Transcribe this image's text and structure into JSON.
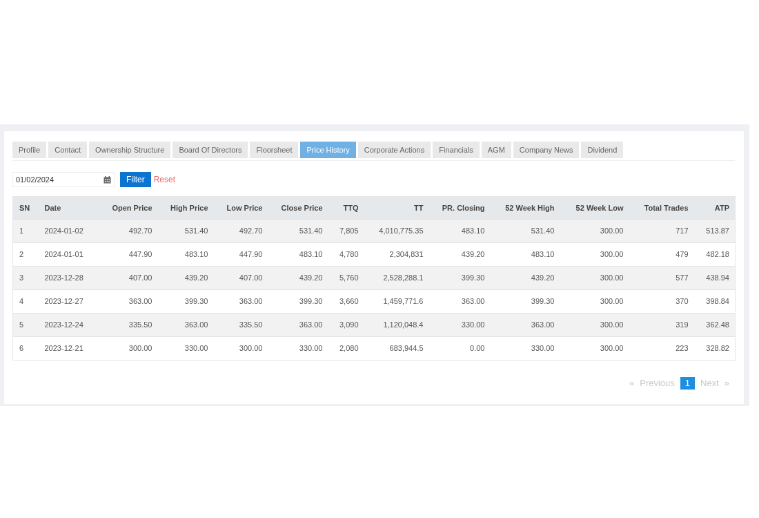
{
  "tabs": [
    {
      "label": "Profile",
      "selected": false
    },
    {
      "label": "Contact",
      "selected": false
    },
    {
      "label": "Ownership Structure",
      "selected": false
    },
    {
      "label": "Board Of Directors",
      "selected": false
    },
    {
      "label": "Floorsheet",
      "selected": false
    },
    {
      "label": "Price History",
      "selected": true
    },
    {
      "label": "Corporate Actions",
      "selected": false
    },
    {
      "label": "Financials",
      "selected": false
    },
    {
      "label": "AGM",
      "selected": false
    },
    {
      "label": "Company News",
      "selected": false
    },
    {
      "label": "Dividend",
      "selected": false
    }
  ],
  "filter": {
    "date": "01/02/2024",
    "filter_button": "Filter",
    "reset_link": "Reset"
  },
  "table": {
    "columns": [
      "SN",
      "Date",
      "Open Price",
      "High Price",
      "Low Price",
      "Close Price",
      "TTQ",
      "TT",
      "PR. Closing",
      "52 Week High",
      "52 Week Low",
      "Total Trades",
      "ATP"
    ],
    "rows": [
      [
        "1",
        "2024-01-02",
        "492.70",
        "531.40",
        "492.70",
        "531.40",
        "7,805",
        "4,010,775.35",
        "483.10",
        "531.40",
        "300.00",
        "717",
        "513.87"
      ],
      [
        "2",
        "2024-01-01",
        "447.90",
        "483.10",
        "447.90",
        "483.10",
        "4,780",
        "2,304,831",
        "439.20",
        "483.10",
        "300.00",
        "479",
        "482.18"
      ],
      [
        "3",
        "2023-12-28",
        "407.00",
        "439.20",
        "407.00",
        "439.20",
        "5,760",
        "2,528,288.1",
        "399.30",
        "439.20",
        "300.00",
        "577",
        "438.94"
      ],
      [
        "4",
        "2023-12-27",
        "363.00",
        "399.30",
        "363.00",
        "399.30",
        "3,660",
        "1,459,771.6",
        "363.00",
        "399.30",
        "300.00",
        "370",
        "398.84"
      ],
      [
        "5",
        "2023-12-24",
        "335.50",
        "363.00",
        "335.50",
        "363.00",
        "3,090",
        "1,120,048.4",
        "330.00",
        "363.00",
        "300.00",
        "319",
        "362.48"
      ],
      [
        "6",
        "2023-12-21",
        "300.00",
        "330.00",
        "300.00",
        "330.00",
        "2,080",
        "683,944.5",
        "0.00",
        "330.00",
        "300.00",
        "223",
        "328.82"
      ]
    ]
  },
  "pagination": {
    "previous": {
      "arrow": "«",
      "label": "Previous",
      "disabled": true
    },
    "pages": [
      {
        "label": "1",
        "selected": true
      }
    ],
    "next": {
      "label": "Next",
      "arrow": "»",
      "disabled": true
    }
  }
}
